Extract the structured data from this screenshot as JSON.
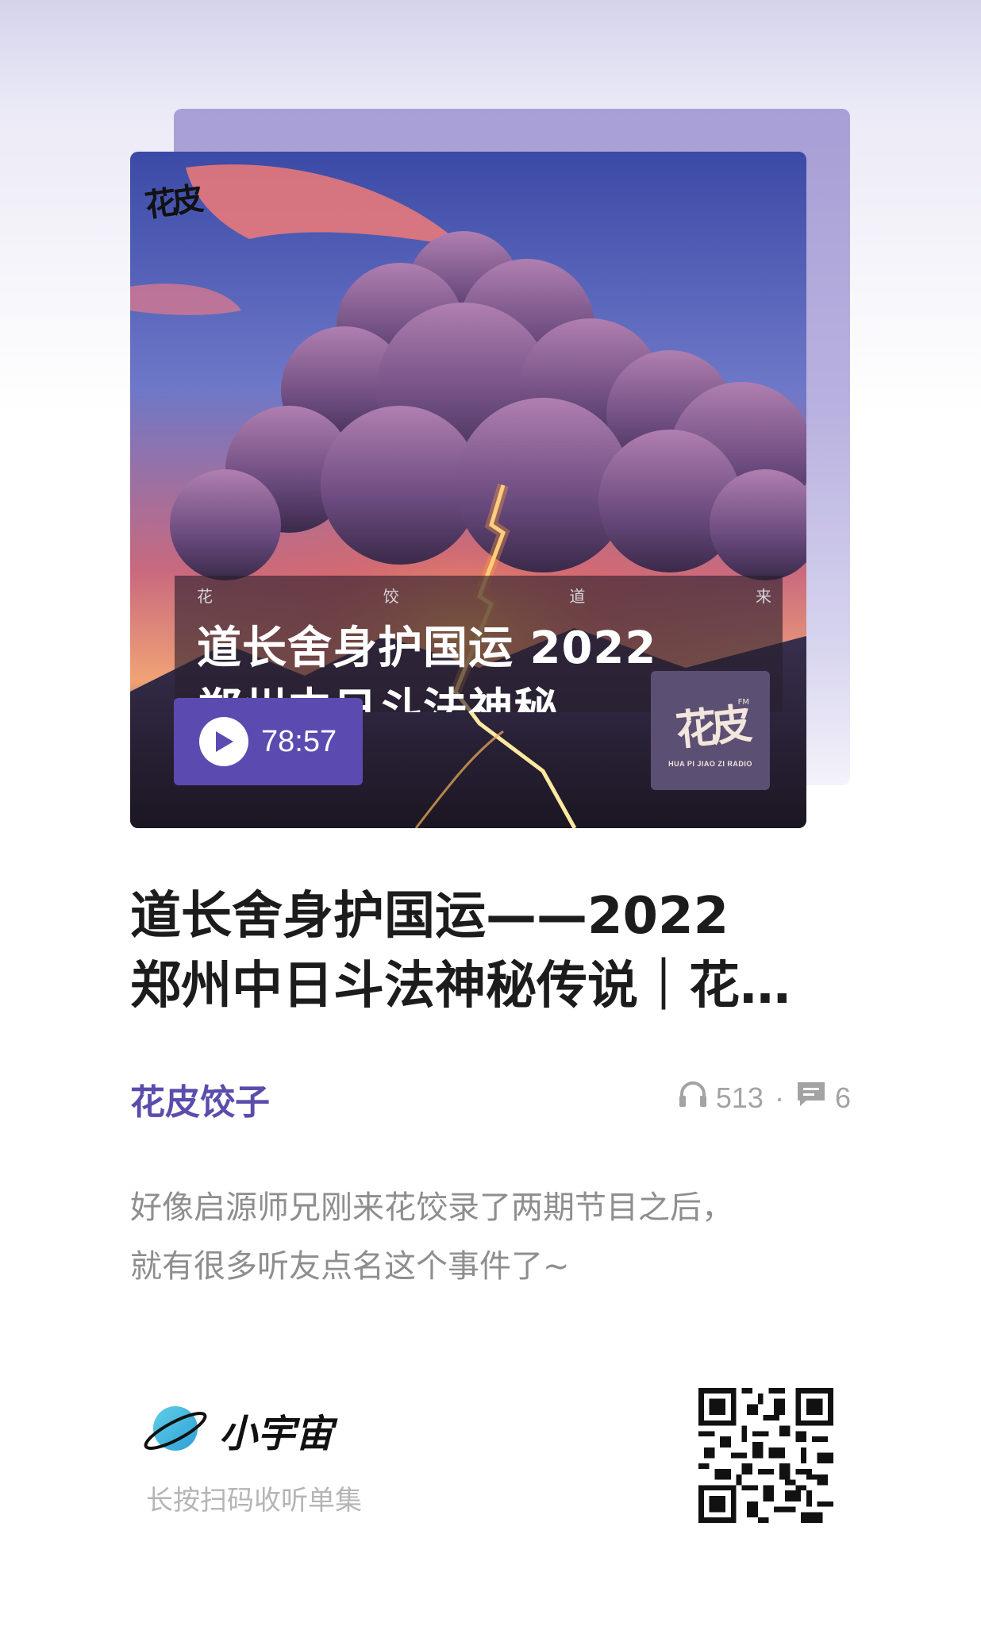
{
  "cover": {
    "brand_mark": "花皮",
    "banner_sub": [
      "花",
      "饺",
      "道",
      "来"
    ],
    "banner_title_line1": "道长舍身护国运 2022",
    "banner_title_line2": "郑州中日斗法神秘",
    "duration": "78:57",
    "station": {
      "glyph": "花皮",
      "fm": "FM",
      "sub": "HUA PI JIAO ZI RADIO"
    }
  },
  "episode": {
    "title_line1": "道长舍身护国运——2022",
    "title_line2": "郑州中日斗法神秘传说｜花…",
    "author": "花皮饺子",
    "plays": "513",
    "separator": "·",
    "comments": "6",
    "description_line1": "好像启源师兄刚来花饺录了两期节目之后，",
    "description_line2": "就有很多听友点名这个事件了~"
  },
  "footer": {
    "brand_name": "小宇宙",
    "hint": "长按扫码收听单集"
  },
  "colors": {
    "accent": "#5b4bb0",
    "author": "#5a4dab",
    "muted": "#a3a3a3"
  },
  "icons": [
    "play-icon",
    "headphones-icon",
    "comment-icon",
    "planet-logo-icon",
    "qr-code"
  ]
}
